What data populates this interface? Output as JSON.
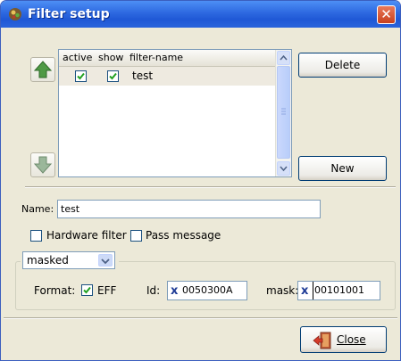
{
  "window": {
    "title": "Filter setup",
    "icons": {
      "app": "filter-app-icon",
      "close": "close-icon"
    },
    "colors": {
      "titlebar": "#2d68e0",
      "face": "#ece9d8",
      "close": "#c8401e"
    }
  },
  "list": {
    "columns": [
      "active",
      "show",
      "filter-name"
    ],
    "rows": [
      {
        "active": true,
        "show": true,
        "name": "test"
      }
    ]
  },
  "buttons": {
    "delete": "Delete",
    "new": "New",
    "close": "Close",
    "up_icon": "up-arrow-icon",
    "down_icon": "down-arrow-icon"
  },
  "form": {
    "name_label": "Name:",
    "name_value": "test",
    "hardware_filter_label": "Hardware filter",
    "hardware_filter_checked": false,
    "pass_message_label": "Pass message",
    "pass_message_checked": false,
    "mode_value": "masked",
    "format_label": "Format:",
    "eff_label": "EFF",
    "eff_checked": true,
    "id_label": "Id:",
    "id_value": "0050300A",
    "mask_label": "mask:",
    "mask_value": "00101001",
    "hex_prefix": "x"
  }
}
